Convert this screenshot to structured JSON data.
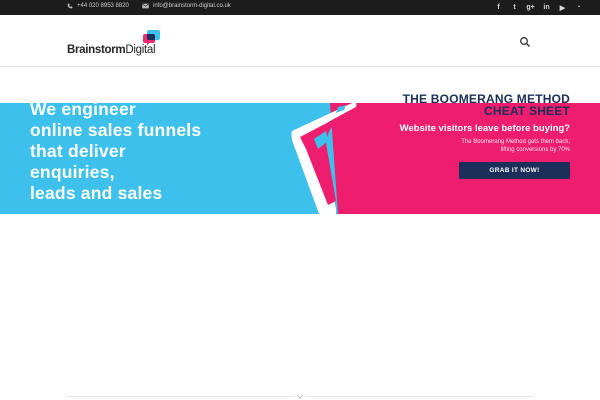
{
  "topbar": {
    "phone": "+44 020 8953 8820",
    "email": "info@brainstorm-digital.co.uk",
    "social": [
      {
        "icon": "facebook-icon",
        "glyph": "f"
      },
      {
        "icon": "twitter-icon",
        "glyph": "t"
      },
      {
        "icon": "google-plus-icon",
        "glyph": "g+"
      },
      {
        "icon": "linkedin-icon",
        "glyph": "in"
      },
      {
        "icon": "youtube-icon",
        "glyph": "▶"
      },
      {
        "icon": "rss-icon",
        "glyph": "◔"
      }
    ]
  },
  "header": {
    "logo_part1": "Brainstorm",
    "logo_part2": "Digital",
    "search_icon": "search-icon"
  },
  "hero": {
    "headline": [
      "We engineer",
      "online sales funnels",
      "that deliver",
      "enquiries,",
      "leads and sales"
    ],
    "cheat_title_1": "THE BOOMERANG METHOD",
    "cheat_title_2": "CHEAT SHEET",
    "cheat_subtitle": "Website visitors leave before buying?",
    "cheat_body_1": "The Boomerang Method gets them back,",
    "cheat_body_2": "lifting conversions by 70%",
    "cta_label": "GRAB IT NOW!"
  },
  "colors": {
    "topbar": "#1c1c1c",
    "hero_blue": "#3ec0ec",
    "hero_pink": "#ee1d6d",
    "navy": "#1b2f5a"
  }
}
